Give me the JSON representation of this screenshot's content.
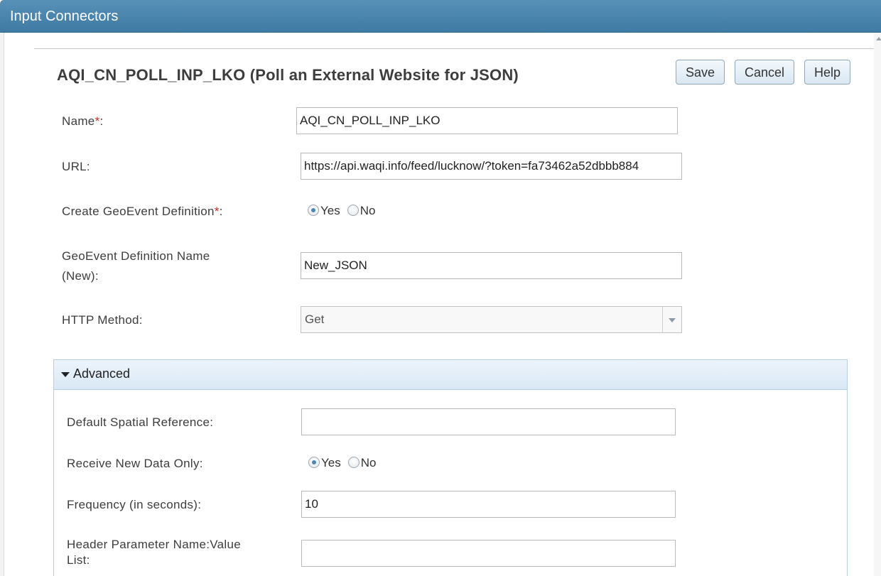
{
  "window": {
    "title": "Input Connectors"
  },
  "page": {
    "title": "AQI_CN_POLL_INP_LKO (Poll an External Website for JSON)"
  },
  "toolbar": {
    "save_label": "Save",
    "cancel_label": "Cancel",
    "help_label": "Help"
  },
  "form": {
    "name": {
      "label": "Name",
      "required_mark": "*",
      "suffix": ":",
      "value": "AQI_CN_POLL_INP_LKO"
    },
    "url": {
      "label": "URL:",
      "value": "https://api.waqi.info/feed/lucknow/?token=fa73462a52dbbb884"
    },
    "create_geoevent_def": {
      "label": "Create GeoEvent Definition",
      "required_mark": "*",
      "suffix": ":",
      "yes_label": "Yes",
      "no_label": "No",
      "selected": "Yes"
    },
    "geoevent_def_name": {
      "label_line1": "GeoEvent Definition Name",
      "label_line2": "(New):",
      "value": "New_JSON"
    },
    "http_method": {
      "label": "HTTP Method:",
      "value": "Get"
    }
  },
  "advanced": {
    "title": "Advanced",
    "default_spatial_ref": {
      "label": "Default Spatial Reference:",
      "value": ""
    },
    "receive_new_data_only": {
      "label": "Receive New Data Only:",
      "yes_label": "Yes",
      "no_label": "No",
      "selected": "Yes"
    },
    "frequency": {
      "label": "Frequency (in seconds):",
      "value": "10"
    },
    "header_params": {
      "label_line1": "Header Parameter Name:Value",
      "label_line2": "List:",
      "value": ""
    }
  },
  "colors": {
    "titlebar": "#4a86b0",
    "required": "#d52121",
    "button_border": "#8fa8bd",
    "panel_header": "#dde9f5"
  }
}
